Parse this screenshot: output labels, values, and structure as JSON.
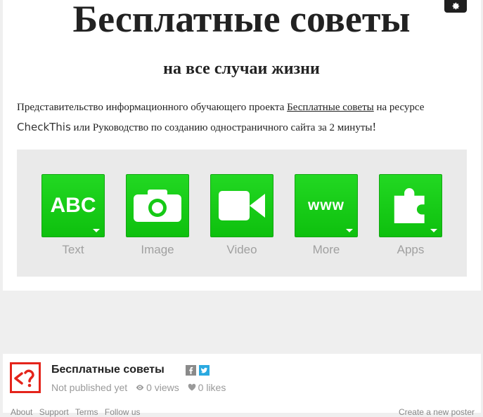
{
  "header": {
    "title": "Бесплатные советы",
    "subtitle": "на все случаи жизни",
    "settings_icon": "gear-icon"
  },
  "description": {
    "part1": "Представительство информационного обучающего проекта ",
    "link1": "Бесплатные советы",
    "part2": " на ресурсе ",
    "brand": "CheckThis",
    "part3": " или Руководство по созданию одностраничного сайта за 2 минуты",
    "part4": "!"
  },
  "tools": [
    {
      "label": "Text",
      "tile_text": "ABC",
      "icon": "abc-text-icon"
    },
    {
      "label": "Image",
      "icon": "camera-icon"
    },
    {
      "label": "Video",
      "icon": "video-camera-icon"
    },
    {
      "label": "More",
      "tile_text": "www",
      "icon": "www-icon"
    },
    {
      "label": "Apps",
      "icon": "puzzle-piece-icon"
    }
  ],
  "footer": {
    "title": "Бесплатные советы",
    "status": "Not published yet",
    "views": "0 views",
    "likes": "0 likes",
    "links": [
      "About",
      "Support",
      "Terms",
      "Follow us"
    ],
    "cta": "Create a new poster"
  },
  "colors": {
    "tile_green": "#16c916",
    "logo_red": "#e4241b",
    "twitter_blue": "#2aa9e0"
  }
}
